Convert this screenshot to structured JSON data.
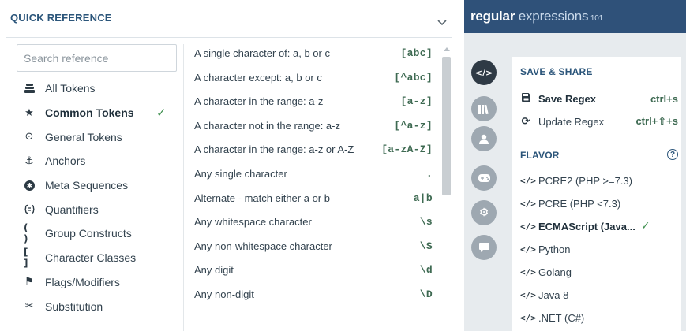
{
  "quick_reference": {
    "title": "QUICK REFERENCE",
    "search_placeholder": "Search reference",
    "categories": [
      {
        "label": "All Tokens",
        "icon": "layers-icon",
        "active": false
      },
      {
        "label": "Common Tokens",
        "icon": "star-icon",
        "active": true
      },
      {
        "label": "General Tokens",
        "icon": "target-icon",
        "active": false
      },
      {
        "label": "Anchors",
        "icon": "anchor-icon",
        "active": false
      },
      {
        "label": "Meta Sequences",
        "icon": "asterisk-circle-icon",
        "active": false
      },
      {
        "label": "Quantifiers",
        "icon": "quantifier-icon",
        "active": false
      },
      {
        "label": "Group Constructs",
        "icon": "parentheses-icon",
        "active": false
      },
      {
        "label": "Character Classes",
        "icon": "brackets-icon",
        "active": false
      },
      {
        "label": "Flags/Modifiers",
        "icon": "flag-icon",
        "active": false
      },
      {
        "label": "Substitution",
        "icon": "scissors-icon",
        "active": false
      }
    ],
    "tokens": [
      {
        "desc": "A single character of: a, b or c",
        "code": "[abc]"
      },
      {
        "desc": "A character except: a, b or c",
        "code": "[^abc]"
      },
      {
        "desc": "A character in the range: a-z",
        "code": "[a-z]"
      },
      {
        "desc": "A character not in the range: a-z",
        "code": "[^a-z]"
      },
      {
        "desc": "A character in the range: a-z or A-Z",
        "code": "[a-zA-Z]"
      },
      {
        "desc": "Any single character",
        "code": "."
      },
      {
        "desc": "Alternate - match either a or b",
        "code": "a|b"
      },
      {
        "desc": "Any whitespace character",
        "code": "\\s"
      },
      {
        "desc": "Any non-whitespace character",
        "code": "\\S"
      },
      {
        "desc": "Any digit",
        "code": "\\d"
      },
      {
        "desc": "Any non-digit",
        "code": "\\D"
      }
    ]
  },
  "brand": {
    "part1": "regular",
    "part2": " expressions",
    "part3": " 101"
  },
  "save_share": {
    "title": "SAVE & SHARE",
    "save_label": "Save Regex",
    "save_shortcut": "ctrl+s",
    "update_label": "Update Regex",
    "update_shortcut": "ctrl+⇧+s"
  },
  "flavor": {
    "title": "FLAVOR",
    "help": "?",
    "items": [
      {
        "label": "PCRE2 (PHP >=7.3)",
        "selected": false
      },
      {
        "label": "PCRE (PHP <7.3)",
        "selected": false
      },
      {
        "label": "ECMAScript (Java...",
        "selected": true
      },
      {
        "label": "Python",
        "selected": false
      },
      {
        "label": "Golang",
        "selected": false
      },
      {
        "label": "Java 8",
        "selected": false
      },
      {
        "label": ".NET (C#)",
        "selected": false
      }
    ]
  },
  "colors": {
    "brand_bar": "#2f5179",
    "accent_green": "#3f8f4f",
    "title_blue": "#2b557a"
  }
}
